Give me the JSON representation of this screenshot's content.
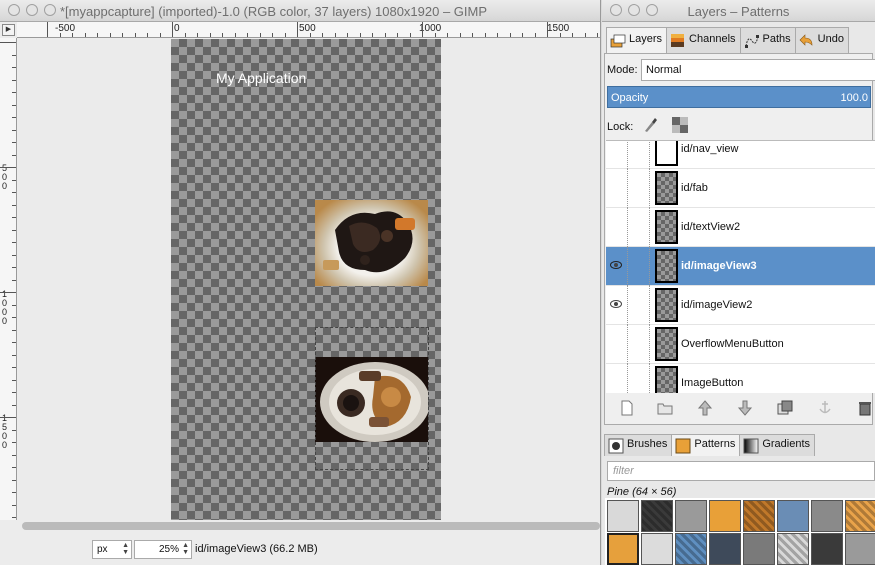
{
  "image_window": {
    "title": "*[myappcapture] (imported)-1.0 (RGB color, 37 layers) 1080x1920 – GIMP",
    "hruler_labels": [
      "-500",
      "0",
      "500",
      "1000",
      "1500"
    ],
    "vruler_labels": [
      "500",
      "1000",
      "1500"
    ],
    "canvas_app_title": "My Application",
    "status": {
      "unit": "px",
      "zoom": "25%",
      "layer_info": "id/imageView3 (66.2 MB)"
    }
  },
  "dock": {
    "title": "Layers – Patterns",
    "tabs": [
      {
        "label": "Layers",
        "icon": "layers-icon"
      },
      {
        "label": "Channels",
        "icon": "channels-icon"
      },
      {
        "label": "Paths",
        "icon": "paths-icon"
      },
      {
        "label": "Undo",
        "icon": "undo-icon"
      }
    ],
    "mode_label": "Mode:",
    "mode_value": "Normal",
    "opacity_label": "Opacity",
    "opacity_value": "100.0",
    "lock_label": "Lock:",
    "layers": [
      {
        "name": "id/nav_view",
        "visible": false,
        "selected": false
      },
      {
        "name": "id/fab",
        "visible": false,
        "selected": false
      },
      {
        "name": "id/textView2",
        "visible": false,
        "selected": false
      },
      {
        "name": "id/imageView3",
        "visible": true,
        "selected": true
      },
      {
        "name": "id/imageView2",
        "visible": true,
        "selected": false
      },
      {
        "name": "OverflowMenuButton",
        "visible": false,
        "selected": false
      },
      {
        "name": "ImageButton",
        "visible": false,
        "selected": false
      }
    ],
    "layer_buttons": [
      "new-layer-icon",
      "new-group-icon",
      "raise-layer-icon",
      "lower-layer-icon",
      "duplicate-layer-icon",
      "anchor-layer-icon",
      "delete-layer-icon"
    ],
    "bottom_tabs": [
      {
        "label": "Brushes",
        "icon": "brushes-icon"
      },
      {
        "label": "Patterns",
        "icon": "patterns-icon"
      },
      {
        "label": "Gradients",
        "icon": "gradients-icon"
      }
    ],
    "filter_placeholder": "filter",
    "pattern_name": "Pine (64 × 56)",
    "pattern_colors": [
      "#d9d9d9",
      "#3a3a3a",
      "#9a9a9a",
      "#e8a038",
      "#c0782a",
      "#6a8db5",
      "#8a8a8a",
      "#e9a34a",
      "#e6a03c",
      "#dcdcdc",
      "#5f8fc0",
      "#3e4a5a",
      "#7a7a7a"
    ]
  }
}
